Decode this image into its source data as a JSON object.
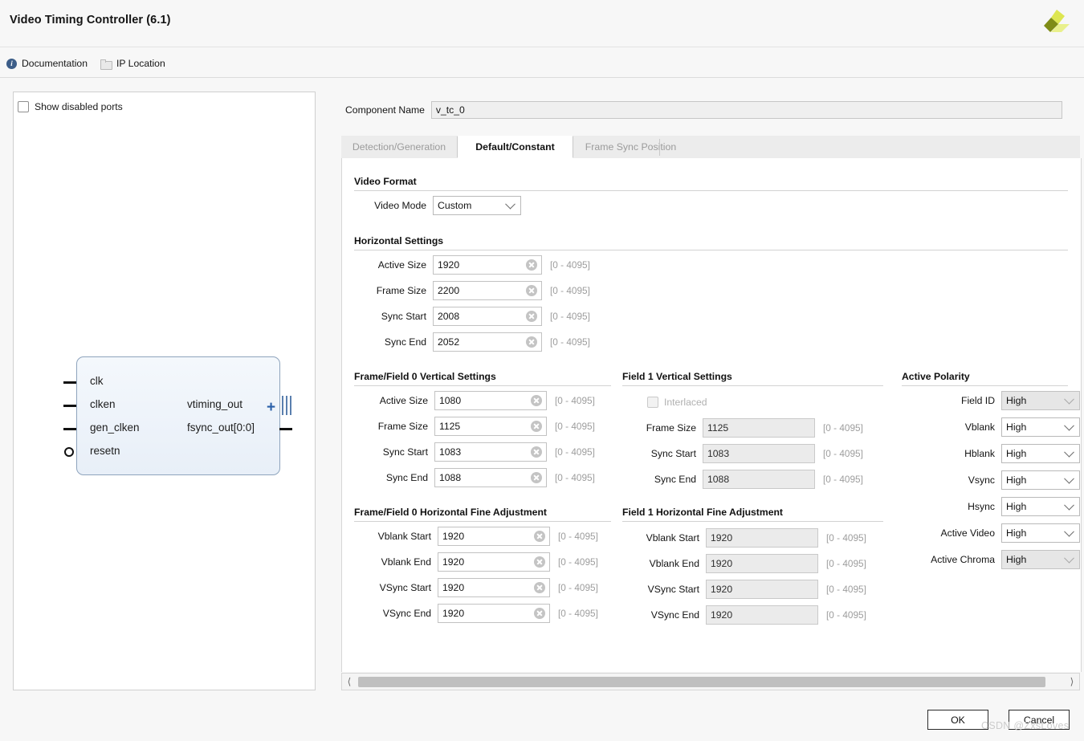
{
  "dialog": {
    "title": "Video Timing Controller (6.1)",
    "links": [
      {
        "label": "Documentation",
        "icon": "info-icon"
      },
      {
        "label": "IP Location",
        "icon": "folder-icon"
      }
    ],
    "logo_colors": {
      "light": "#e8ef6e",
      "mid": "#c9d21f",
      "dark": "#7f8c16"
    }
  },
  "left_panel": {
    "show_disabled_ports": {
      "label": "Show disabled ports",
      "checked": false
    },
    "symbol": {
      "inputs": [
        "clk",
        "clken",
        "gen_clken",
        "resetn"
      ],
      "outputs": [
        "vtiming_out",
        "fsync_out[0:0]"
      ]
    }
  },
  "component": {
    "label": "Component Name",
    "value": "v_tc_0"
  },
  "tabs": [
    {
      "label": "Detection/Generation",
      "active": false
    },
    {
      "label": "Default/Constant",
      "active": true
    },
    {
      "label": "Frame Sync Position",
      "active": false
    }
  ],
  "sections": {
    "video_format": {
      "title": "Video Format",
      "video_mode": {
        "label": "Video Mode",
        "value": "Custom"
      }
    },
    "horizontal": {
      "title": "Horizontal Settings",
      "rows": [
        {
          "label": "Active Size",
          "value": "1920",
          "range": "[0 - 4095]"
        },
        {
          "label": "Frame Size",
          "value": "2200",
          "range": "[0 - 4095]"
        },
        {
          "label": "Sync Start",
          "value": "2008",
          "range": "[0 - 4095]"
        },
        {
          "label": "Sync End",
          "value": "2052",
          "range": "[0 - 4095]"
        }
      ]
    },
    "frame_field0_vertical": {
      "title": "Frame/Field 0 Vertical Settings",
      "rows": [
        {
          "label": "Active Size",
          "value": "1080",
          "range": "[0 - 4095]"
        },
        {
          "label": "Frame Size",
          "value": "1125",
          "range": "[0 - 4095]"
        },
        {
          "label": "Sync Start",
          "value": "1083",
          "range": "[0 - 4095]"
        },
        {
          "label": "Sync End",
          "value": "1088",
          "range": "[0 - 4095]"
        }
      ]
    },
    "field1_vertical": {
      "title": "Field 1 Vertical Settings",
      "interlaced": {
        "label": "Interlaced",
        "checked": false,
        "disabled": true
      },
      "rows": [
        {
          "label": "Frame Size",
          "value": "1125",
          "range": "[0 - 4095]"
        },
        {
          "label": "Sync Start",
          "value": "1083",
          "range": "[0 - 4095]"
        },
        {
          "label": "Sync End",
          "value": "1088",
          "range": "[0 - 4095]"
        }
      ]
    },
    "frame_field0_hfine": {
      "title": "Frame/Field 0 Horizontal Fine Adjustment",
      "rows": [
        {
          "label": "Vblank Start",
          "value": "1920",
          "range": "[0 - 4095]"
        },
        {
          "label": "Vblank End",
          "value": "1920",
          "range": "[0 - 4095]"
        },
        {
          "label": "VSync Start",
          "value": "1920",
          "range": "[0 - 4095]"
        },
        {
          "label": "VSync End",
          "value": "1920",
          "range": "[0 - 4095]"
        }
      ]
    },
    "field1_hfine": {
      "title": "Field 1 Horizontal Fine Adjustment",
      "rows": [
        {
          "label": "Vblank Start",
          "value": "1920",
          "range": "[0 - 4095]"
        },
        {
          "label": "Vblank End",
          "value": "1920",
          "range": "[0 - 4095]"
        },
        {
          "label": "VSync Start",
          "value": "1920",
          "range": "[0 - 4095]"
        },
        {
          "label": "VSync End",
          "value": "1920",
          "range": "[0 - 4095]"
        }
      ]
    },
    "active_polarity": {
      "title": "Active Polarity",
      "rows": [
        {
          "label": "Field ID",
          "value": "High",
          "disabled": true
        },
        {
          "label": "Vblank",
          "value": "High",
          "disabled": false
        },
        {
          "label": "Hblank",
          "value": "High",
          "disabled": false
        },
        {
          "label": "Vsync",
          "value": "High",
          "disabled": false
        },
        {
          "label": "Hsync",
          "value": "High",
          "disabled": false
        },
        {
          "label": "Active Video",
          "value": "High",
          "disabled": false
        },
        {
          "label": "Active Chroma",
          "value": "High",
          "disabled": true
        }
      ]
    }
  },
  "footer": {
    "ok": "OK",
    "cancel": "Cancel",
    "watermark": "CSDN @ZxsLoves"
  }
}
